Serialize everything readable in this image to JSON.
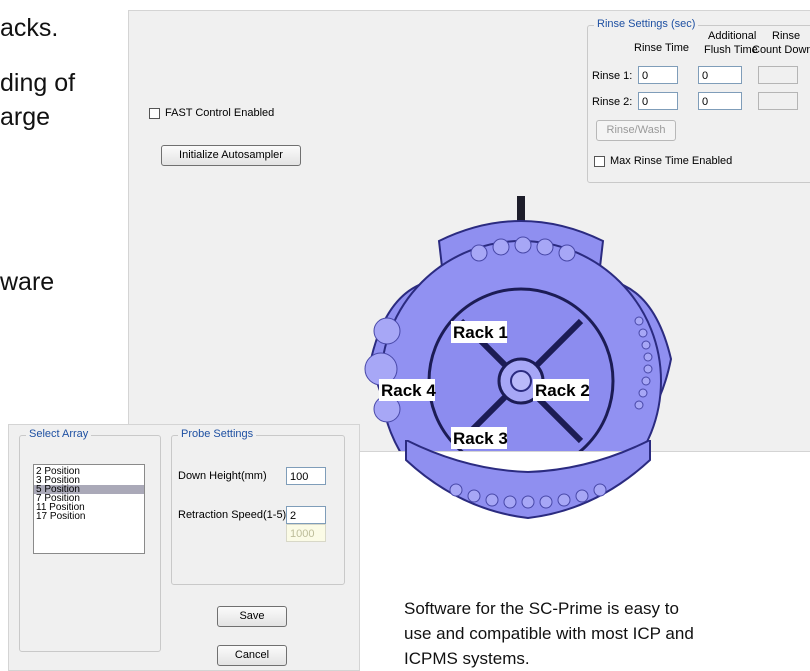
{
  "slide": {
    "fragments": [
      "acks.",
      "ding of",
      "arge",
      "ware"
    ],
    "caption_lines": [
      "Software for the SC-Prime is easy to",
      "use and compatible with most ICP and",
      "ICPMS systems."
    ]
  },
  "main_window": {
    "fast_control_label": "FAST Control Enabled",
    "fast_control_checked": false,
    "initialize_button": "Initialize Autosampler",
    "rinse": {
      "group_title": "Rinse Settings (sec)",
      "col_rinse_time": "Rinse Time",
      "col_additional_1": "Additional",
      "col_additional_2": "Flush Time",
      "col_countdown_1": "Rinse",
      "col_countdown_2": "Count Down",
      "rows": [
        {
          "label": "Rinse 1:",
          "rinse_time": "0",
          "flush_time": "0",
          "countdown": ""
        },
        {
          "label": "Rinse 2:",
          "rinse_time": "0",
          "flush_time": "0",
          "countdown": ""
        }
      ],
      "rinse_wash_button": "Rinse/Wash",
      "max_rinse_label": "Max Rinse Time Enabled",
      "max_rinse_checked": false
    }
  },
  "tray": {
    "racks": [
      "Rack 1",
      "Rack 2",
      "Rack 3",
      "Rack 4"
    ],
    "color": "#8f8ff0"
  },
  "array_window": {
    "select_array": {
      "group_title": "Select Array",
      "options": [
        "2 Position",
        "3 Position",
        "5 Position",
        "7 Position",
        "11 Position",
        "17 Position"
      ],
      "selected": "5 Position"
    },
    "probe": {
      "group_title": "Probe Settings",
      "down_height_label": "Down Height(mm)",
      "down_height_value": "100",
      "retraction_label": "Retraction Speed(1-5)",
      "retraction_value": "2",
      "extra_value": "1000"
    },
    "save_button": "Save",
    "cancel_button": "Cancel"
  }
}
